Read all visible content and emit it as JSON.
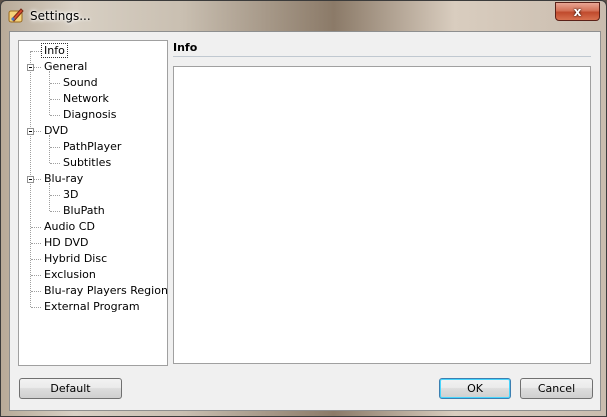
{
  "window": {
    "title": "Settings...",
    "close_symbol": "x"
  },
  "tree": {
    "items": [
      {
        "label": "Info",
        "level": 0,
        "selected": true
      },
      {
        "label": "General",
        "level": 0,
        "expander": "minus"
      },
      {
        "label": "Sound",
        "level": 1
      },
      {
        "label": "Network",
        "level": 1
      },
      {
        "label": "Diagnosis",
        "level": 1
      },
      {
        "label": "DVD",
        "level": 0,
        "expander": "minus"
      },
      {
        "label": "PathPlayer",
        "level": 1
      },
      {
        "label": "Subtitles",
        "level": 1
      },
      {
        "label": "Blu-ray",
        "level": 0,
        "expander": "minus"
      },
      {
        "label": "3D",
        "level": 1
      },
      {
        "label": "BluPath",
        "level": 1
      },
      {
        "label": "Audio CD",
        "level": 0
      },
      {
        "label": "HD DVD",
        "level": 0
      },
      {
        "label": "Hybrid Disc",
        "level": 0
      },
      {
        "label": "Exclusion",
        "level": 0
      },
      {
        "label": "Blu-ray Players Region",
        "level": 0
      },
      {
        "label": "External Program",
        "level": 0
      }
    ]
  },
  "panel": {
    "title": "Info"
  },
  "buttons": {
    "default_label": "Default",
    "ok_label": "OK",
    "cancel_label": "Cancel"
  },
  "colors": {
    "close_button": "#c75a3d",
    "focus_border": "#3c7fb1"
  }
}
